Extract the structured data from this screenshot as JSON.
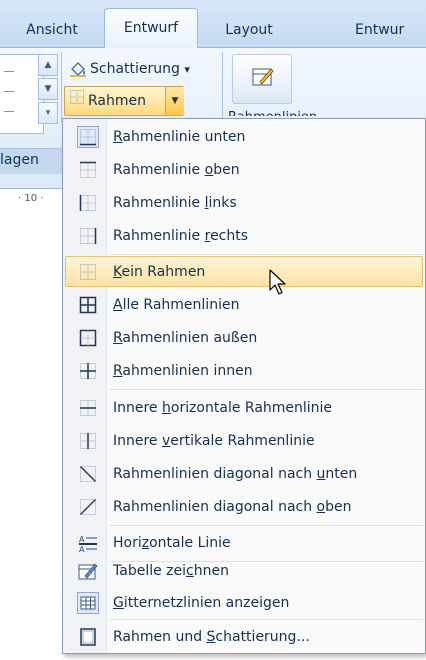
{
  "ribbon": {
    "tabs": [
      {
        "label": "Ansicht"
      },
      {
        "label": "Entwurf"
      },
      {
        "label": "Layout"
      },
      {
        "label": "Entwur"
      }
    ],
    "shading_label": "Schattierung",
    "shading_arrow": "▾",
    "borders_label": "Rahmen",
    "group_label": "lagen",
    "ruler_text": "· 10 ·",
    "draw_table_label": "Rahmenlinien"
  },
  "menu": {
    "items": [
      {
        "pre": "",
        "key": "R",
        "post": "ahmenlinie unten"
      },
      {
        "pre": "Rahmenlinie ",
        "key": "o",
        "post": "ben"
      },
      {
        "pre": "Rahmenlinie ",
        "key": "l",
        "post": "inks"
      },
      {
        "pre": "Rahmenlinie ",
        "key": "r",
        "post": "echts"
      },
      {
        "pre": "",
        "key": "K",
        "post": "ein Rahmen"
      },
      {
        "pre": "",
        "key": "A",
        "post": "lle Rahmenlinien"
      },
      {
        "pre": "",
        "key": "R",
        "post": "ahmenlinien außen"
      },
      {
        "pre": "",
        "key": "R",
        "post": "ahmenlinien innen"
      },
      {
        "pre": "Innere ",
        "key": "h",
        "post": "orizontale Rahmenlinie"
      },
      {
        "pre": "Innere ",
        "key": "v",
        "post": "ertikale Rahmenlinie"
      },
      {
        "pre": "Rahmenlinien diagonal nach ",
        "key": "u",
        "post": "nten"
      },
      {
        "pre": "Rahmenlinien diagonal nach ",
        "key": "o",
        "post": "ben"
      },
      {
        "pre": "Hori",
        "key": "z",
        "post": "ontale Linie"
      },
      {
        "pre": "Tabelle zei",
        "key": "c",
        "post": "hnen"
      },
      {
        "pre": "",
        "key": "G",
        "post": "itternetzlinien anzeigen"
      },
      {
        "pre": "Rahmen und ",
        "key": "S",
        "post": "chattierung..."
      }
    ]
  },
  "colors": {
    "highlight": "#fbe3a4",
    "text": "#15304f",
    "ribbon": "#dce9f8"
  }
}
